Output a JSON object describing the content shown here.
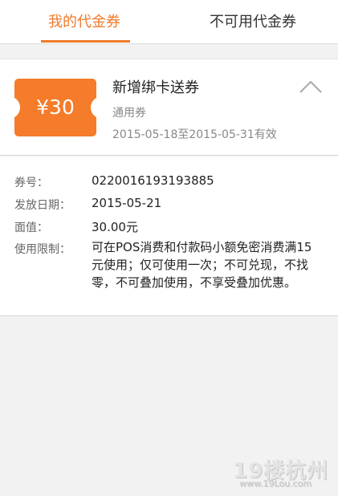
{
  "tabs": {
    "available": "我的代金券",
    "unavailable": "不可用代金券"
  },
  "coupon": {
    "amount": "¥30",
    "title": "新增绑卡送券",
    "type": "通用券",
    "validity": "2015-05-18至2015-05-31有效"
  },
  "details": {
    "coupon_no_label": "券号：",
    "coupon_no": "0220016193193885",
    "issue_date_label": "发放日期：",
    "issue_date": "2015-05-21",
    "face_value_label": "面值：",
    "face_value": "30.00元",
    "restriction_label": "使用限制：",
    "restriction": "可在POS消费和付款码小额免密消费满15元使用；仅可使用一次；不可兑现，不找零，不可叠加使用，不享受叠加优惠。"
  },
  "watermark": {
    "main": "19楼杭州",
    "sub": "www.19Lou.com"
  },
  "colors": {
    "accent": "#f07a2a",
    "ticket": "#f47c2a"
  }
}
